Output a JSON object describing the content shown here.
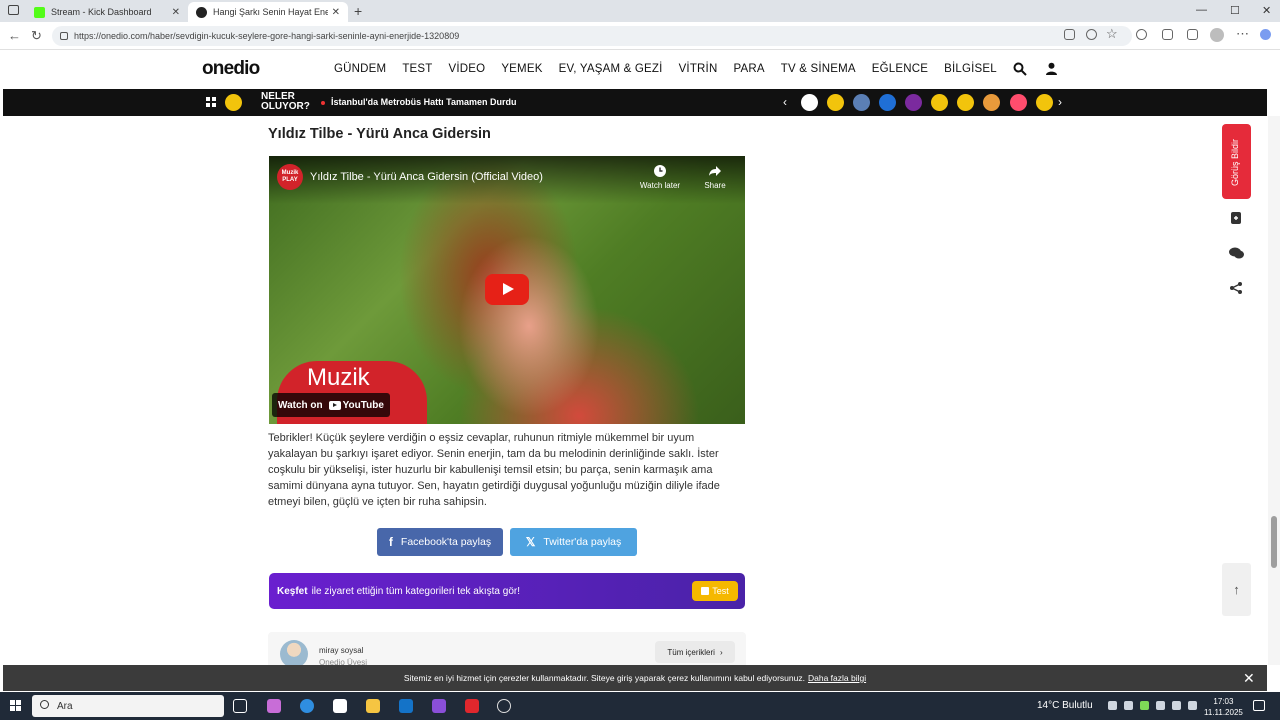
{
  "browser": {
    "tabs": [
      {
        "label": "Stream - Kick Dashboard",
        "favicon_color": "#53fc18",
        "active": false
      },
      {
        "label": "Hangi Şarkı Senin Hayat Enerjini Y",
        "favicon_color": "#222222",
        "active": true
      }
    ],
    "url": "https://onedio.com/haber/sevdigin-kucuk-seylere-gore-hangi-sarki-seninle-ayni-enerjide-1320809"
  },
  "site": {
    "logo": "onedio",
    "nav": [
      "GÜNDEM",
      "TEST",
      "VİDEO",
      "YEMEK",
      "EV, YAŞAM & GEZİ",
      "VİTRİN",
      "PARA",
      "TV & SİNEMA",
      "EĞLENCE",
      "BİLGİSEL"
    ],
    "ticker": {
      "label": "NELER OLUYOR?",
      "headline": "İstanbul'da Metrobüs Hattı Tamamen Durdu",
      "badge_colors": [
        "#ffffff",
        "#f2c40c",
        "#5b7fb5",
        "#1f6fd6",
        "#7b2a9e",
        "#f2c40c",
        "#f2c40c",
        "#e89a3b",
        "#ff4d6d",
        "#f2c40c"
      ]
    }
  },
  "article": {
    "title": "Yıldız Tilbe - Yürü Anca Gidersin",
    "video": {
      "channel": "Muzik PLAY",
      "title": "Yıldız Tilbe - Yürü Anca Gidersin (Official Video)",
      "watch_later": "Watch later",
      "share": "Share",
      "watch_on": "Watch on",
      "youtube": "YouTube",
      "overlay_text": "Muzik"
    },
    "body": "Tebrikler! Küçük şeylere verdiğin o eşsiz cevaplar, ruhunun ritmiyle mükemmel bir uyum yakalayan bu şarkıyı işaret ediyor. Senin enerjin, tam da bu melodinin derinliğinde saklı. İster coşkulu bir yükselişi, ister huzurlu bir kabullenişi temsil etsin; bu parça, senin karmaşık ama samimi dünyana ayna tutuyor. Sen, hayatın getirdiği duygusal yoğunluğu müziğin diliyle ifade etmeyi bilen, güçlü ve içten bir ruha sahipsin.",
    "share_facebook": "Facebook'ta paylaş",
    "share_twitter": "Twitter'da paylaş",
    "kesfet_bold": "Keşfet",
    "kesfet_text": "ile ziyaret ettiğin tüm kategorileri tek akışta gör!",
    "kesfet_button": "Test",
    "author_name": "miray soysal",
    "author_role": "Onedio Üyesi",
    "author_button": "Tüm içerikleri"
  },
  "rail": {
    "report": "Görüş Bildir"
  },
  "cookie": {
    "text": "Sitemiz en iyi hizmet için çerezler kullanmaktadır. Siteye giriş yaparak çerez kullanımını kabul ediyorsunuz.",
    "link": "Daha fazla bilgi"
  },
  "taskbar": {
    "search": "Ara",
    "weather": "14°C  Bulutlu",
    "time": "17:03",
    "date": "11.11.2025"
  }
}
